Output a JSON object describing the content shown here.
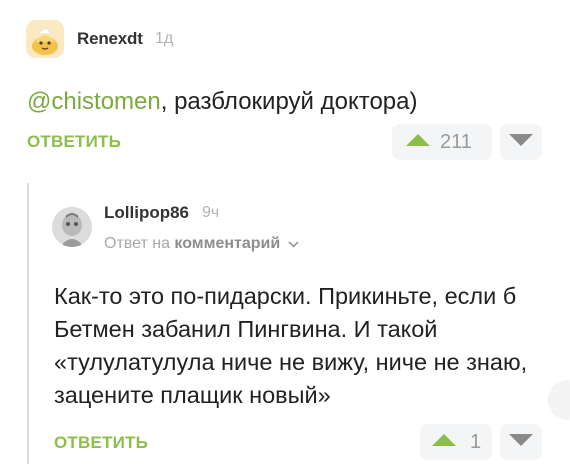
{
  "comment": {
    "author": "Renexdt",
    "time": "1д",
    "mention": "@chistomen",
    "text": ", разблокируй доктора)",
    "reply_label": "ОТВЕТИТЬ",
    "rating": "211"
  },
  "reply": {
    "author": "Lollipop86",
    "time": "9ч",
    "reply_prefix": "Ответ на ",
    "reply_target": "комментарий",
    "text": "Как-то это по-пидарски. Прикиньте, если б Бетмен забанил Пингвина. И такой «тулулатулула ниче не вижу, ниче не знаю, зацените плащик новый»",
    "reply_label": "ОТВЕТИТЬ",
    "rating": "1"
  },
  "icons": {
    "upvote": "triangle-up-icon",
    "downvote": "triangle-down-icon",
    "dropdown": "chevron-down-icon"
  },
  "colors": {
    "accent_green": "#8cbf4a",
    "mention_green": "#7aa93c",
    "muted": "#a8a8a8"
  }
}
